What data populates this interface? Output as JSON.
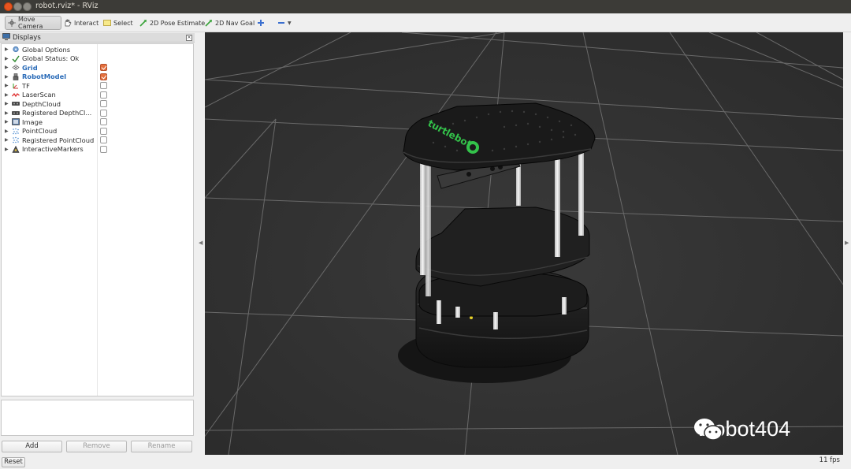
{
  "window": {
    "title": "robot.rviz* - RViz"
  },
  "toolbar": {
    "tools": [
      {
        "label": "Move Camera",
        "icon": "move-camera-icon",
        "active": true
      },
      {
        "label": "Interact",
        "icon": "hand-icon"
      },
      {
        "label": "Select",
        "icon": "select-icon"
      },
      {
        "label": "2D Pose Estimate",
        "icon": "green-arrow-icon"
      },
      {
        "label": "2D Nav Goal",
        "icon": "green-arrow-icon"
      }
    ]
  },
  "displays": {
    "title": "Displays",
    "items": [
      {
        "label": "Global Options",
        "icon": "gear-icon",
        "checkbox": null
      },
      {
        "label": "Global Status: Ok",
        "icon": "check-icon",
        "checkbox": null
      },
      {
        "label": "Grid",
        "icon": "grid-icon",
        "checkbox": true,
        "bold": true
      },
      {
        "label": "RobotModel",
        "icon": "robot-icon",
        "checkbox": true,
        "bold": true
      },
      {
        "label": "TF",
        "icon": "tf-icon",
        "checkbox": false
      },
      {
        "label": "LaserScan",
        "icon": "laser-icon",
        "checkbox": false
      },
      {
        "label": "DepthCloud",
        "icon": "camera-icon",
        "checkbox": false
      },
      {
        "label": "Registered DepthCl...",
        "icon": "camera-icon",
        "checkbox": false
      },
      {
        "label": "Image",
        "icon": "image-icon",
        "checkbox": false
      },
      {
        "label": "PointCloud",
        "icon": "pointcloud-icon",
        "checkbox": false
      },
      {
        "label": "Registered PointCloud",
        "icon": "pointcloud-icon",
        "checkbox": false
      },
      {
        "label": "InteractiveMarkers",
        "icon": "marker-icon",
        "checkbox": false
      }
    ],
    "buttons": {
      "add": "Add",
      "remove": "Remove",
      "rename": "Rename"
    }
  },
  "viewport": {
    "watermark": "Robot404",
    "robot_logo_text": "turtlebot"
  },
  "statusbar": {
    "reset": "Reset",
    "fps": "11 fps"
  },
  "colors": {
    "accent_orange": "#e46f3c",
    "grid_bg": "#303030",
    "robot_logo": "#33c24a"
  }
}
